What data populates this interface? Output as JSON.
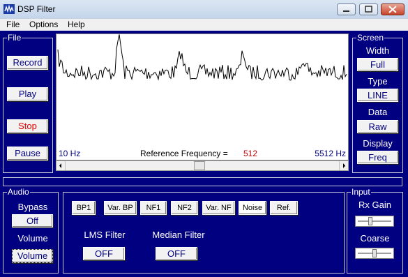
{
  "window": {
    "title": "DSP Filter"
  },
  "menu": [
    "File",
    "Options",
    "Help"
  ],
  "file_group": {
    "label": "File",
    "buttons": [
      "Record",
      "Play",
      "Stop",
      "Pause"
    ]
  },
  "screen_group": {
    "label": "Screen",
    "width": {
      "label": "Width",
      "value": "Full"
    },
    "type": {
      "label": "Type",
      "value": "LINE"
    },
    "data": {
      "label": "Data",
      "value": "Raw"
    },
    "display": {
      "label": "Display",
      "value": "Freq"
    }
  },
  "plot": {
    "x_min_label": "10 Hz",
    "x_max_label": "5512 Hz",
    "ref_label": "Reference Frequency =",
    "ref_value": "512",
    "scroll_value_fraction": 0.49
  },
  "audio_group": {
    "label": "Audio",
    "bypass": {
      "label": "Bypass",
      "value": "Off"
    },
    "volume": {
      "label": "Volume",
      "value": "Volume"
    }
  },
  "filters": {
    "buttons": [
      "BP1",
      "Var. BP",
      "NF1",
      "NF2",
      "Var. NF",
      "Noise",
      "Ref."
    ],
    "selected": "Noise",
    "lms": {
      "label": "LMS Filter",
      "value": "OFF"
    },
    "median": {
      "label": "Median Filter",
      "value": "OFF"
    }
  },
  "input_group": {
    "label": "Input",
    "rx_gain": {
      "label": "Rx Gain",
      "level": 0.35
    },
    "coarse": {
      "label": "Coarse",
      "level": 0.5
    }
  },
  "colors": {
    "panel_bg": "#000080",
    "stop_text": "#e00000",
    "ref_value": "#c00000",
    "title_text": "#000080"
  }
}
